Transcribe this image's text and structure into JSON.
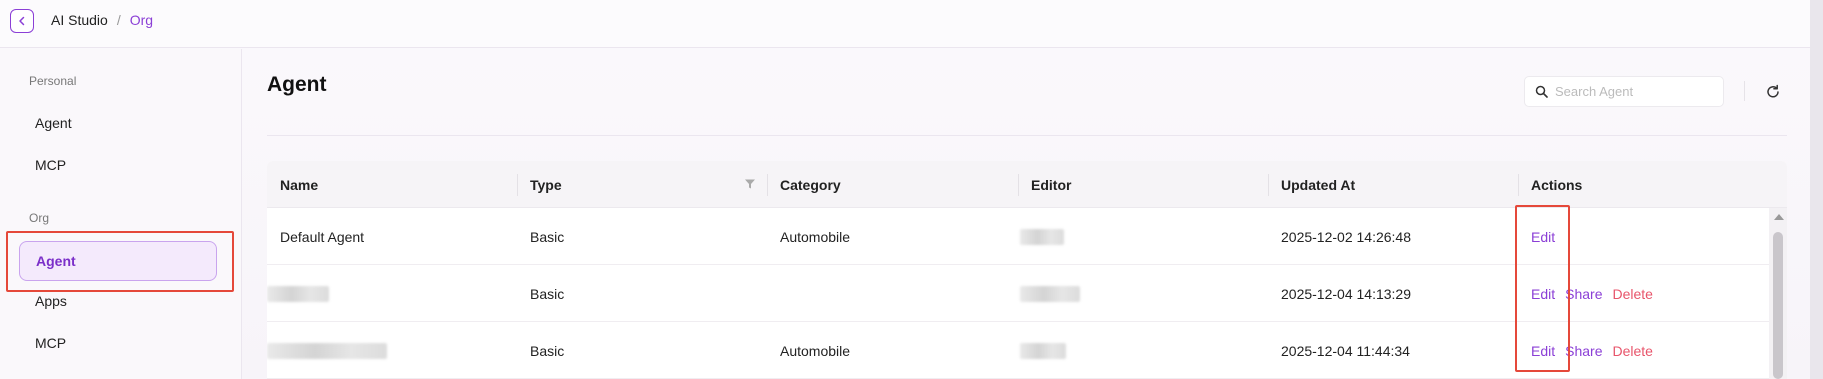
{
  "header": {
    "breadcrumb": [
      "AI Studio",
      "/",
      "Org"
    ]
  },
  "sidebar": {
    "sections": [
      {
        "label": "Personal",
        "items": [
          "Agent",
          "MCP"
        ]
      },
      {
        "label": "Org",
        "items": [
          "Agent",
          "Apps",
          "MCP"
        ],
        "active": "Agent"
      }
    ]
  },
  "main": {
    "title": "Agent",
    "search": {
      "placeholder": "Search Agent"
    },
    "table": {
      "columns": [
        "Name",
        "Type",
        "Category",
        "Editor",
        "Updated At",
        "Actions"
      ],
      "rows": [
        {
          "name": "Default Agent",
          "type": "Basic",
          "category": "Automobile",
          "updated_at": "2025-12-02 14:26:48",
          "actions": [
            "Edit"
          ]
        },
        {
          "name": "",
          "type": "Basic",
          "category": "",
          "updated_at": "2025-12-04 14:13:29",
          "actions": [
            "Edit",
            "Share",
            "Delete"
          ]
        },
        {
          "name": "",
          "type": "Basic",
          "category": "Automobile",
          "updated_at": "2025-12-04 11:44:34",
          "actions": [
            "Edit",
            "Share",
            "Delete"
          ]
        }
      ]
    }
  },
  "colors": {
    "accent": "#8b3fd6",
    "delete": "#e8556b",
    "highlight_box": "#e5483a"
  },
  "icons": [
    "back-icon",
    "search-icon",
    "refresh-icon",
    "filter-icon"
  ]
}
